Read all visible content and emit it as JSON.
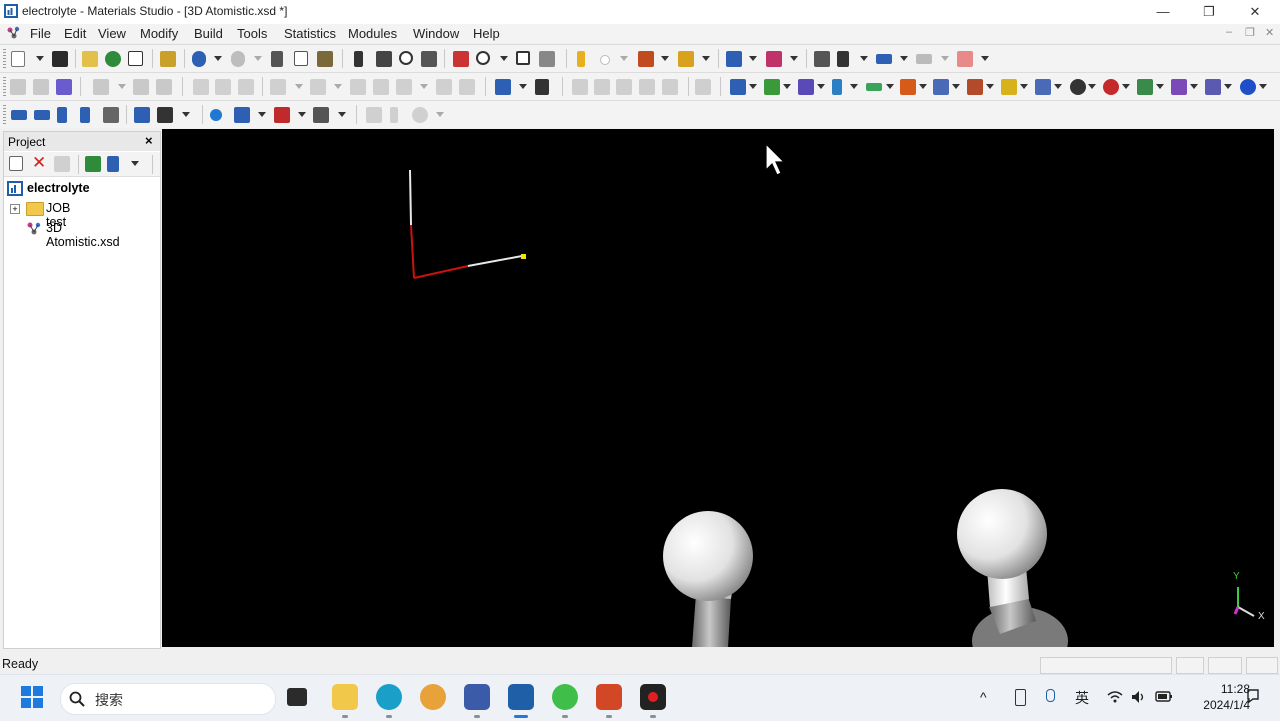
{
  "window": {
    "title": "electrolyte - Materials Studio - [3D Atomistic.xsd *]",
    "minimize_glyph": "—",
    "restore_glyph": "❐",
    "close_glyph": "✕",
    "mdi_minimize_glyph": "–",
    "mdi_restore_glyph": "❐",
    "mdi_close_glyph": "✕"
  },
  "menu": {
    "items": [
      "File",
      "Edit",
      "View",
      "Modify",
      "Build",
      "Tools",
      "Statistics",
      "Modules",
      "Window",
      "Help"
    ]
  },
  "project": {
    "title": "Project",
    "close_glyph": "×",
    "root_label": "electrolyte",
    "folder_label": "JOB test",
    "document_label": "3D Atomistic.xsd",
    "expand_glyph": "+"
  },
  "viewer": {
    "axis_y_label": "Y",
    "axis_x_label": "X"
  },
  "status": {
    "text": "Ready"
  },
  "taskbar": {
    "search_placeholder": "搜索",
    "ime_label": "英",
    "time": "11:28",
    "date": "2024/1/4",
    "caret_glyph": "^"
  },
  "icons": {
    "start": "windows-start-icon",
    "search": "search-icon",
    "tray": [
      "chevron-up-icon",
      "pen-icon",
      "microphone-icon",
      "wifi-icon",
      "volume-icon",
      "battery-icon",
      "notification-icon"
    ]
  },
  "colors": {
    "viewer_background": "#000000",
    "axis_red": "#cc1111",
    "axis_white": "#e8e8e8",
    "axis_yellow": "#f2e600",
    "atom_white": "#eeeeee",
    "bond_gray": "#8a8a8a",
    "triad_y": "#3ccf3c",
    "triad_x": "#dddddd",
    "triad_z": "#cc33cc"
  }
}
